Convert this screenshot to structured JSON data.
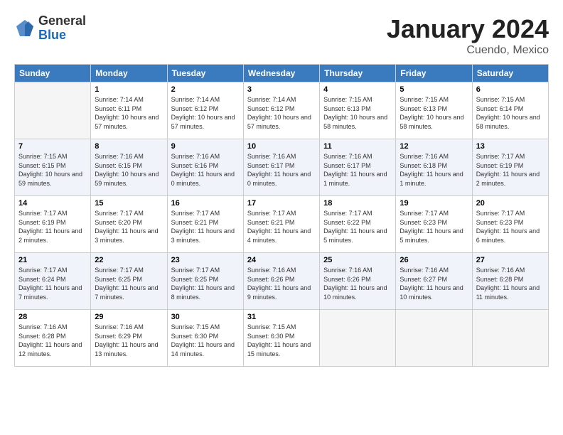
{
  "header": {
    "logo": {
      "line1": "General",
      "line2": "Blue"
    },
    "title": "January 2024",
    "location": "Cuendo, Mexico"
  },
  "weekdays": [
    "Sunday",
    "Monday",
    "Tuesday",
    "Wednesday",
    "Thursday",
    "Friday",
    "Saturday"
  ],
  "weeks": [
    [
      {
        "day": "",
        "sunrise": "",
        "sunset": "",
        "daylight": ""
      },
      {
        "day": "1",
        "sunrise": "Sunrise: 7:14 AM",
        "sunset": "Sunset: 6:11 PM",
        "daylight": "Daylight: 10 hours and 57 minutes."
      },
      {
        "day": "2",
        "sunrise": "Sunrise: 7:14 AM",
        "sunset": "Sunset: 6:12 PM",
        "daylight": "Daylight: 10 hours and 57 minutes."
      },
      {
        "day": "3",
        "sunrise": "Sunrise: 7:14 AM",
        "sunset": "Sunset: 6:12 PM",
        "daylight": "Daylight: 10 hours and 57 minutes."
      },
      {
        "day": "4",
        "sunrise": "Sunrise: 7:15 AM",
        "sunset": "Sunset: 6:13 PM",
        "daylight": "Daylight: 10 hours and 58 minutes."
      },
      {
        "day": "5",
        "sunrise": "Sunrise: 7:15 AM",
        "sunset": "Sunset: 6:13 PM",
        "daylight": "Daylight: 10 hours and 58 minutes."
      },
      {
        "day": "6",
        "sunrise": "Sunrise: 7:15 AM",
        "sunset": "Sunset: 6:14 PM",
        "daylight": "Daylight: 10 hours and 58 minutes."
      }
    ],
    [
      {
        "day": "7",
        "sunrise": "Sunrise: 7:15 AM",
        "sunset": "Sunset: 6:15 PM",
        "daylight": "Daylight: 10 hours and 59 minutes."
      },
      {
        "day": "8",
        "sunrise": "Sunrise: 7:16 AM",
        "sunset": "Sunset: 6:15 PM",
        "daylight": "Daylight: 10 hours and 59 minutes."
      },
      {
        "day": "9",
        "sunrise": "Sunrise: 7:16 AM",
        "sunset": "Sunset: 6:16 PM",
        "daylight": "Daylight: 11 hours and 0 minutes."
      },
      {
        "day": "10",
        "sunrise": "Sunrise: 7:16 AM",
        "sunset": "Sunset: 6:17 PM",
        "daylight": "Daylight: 11 hours and 0 minutes."
      },
      {
        "day": "11",
        "sunrise": "Sunrise: 7:16 AM",
        "sunset": "Sunset: 6:17 PM",
        "daylight": "Daylight: 11 hours and 1 minute."
      },
      {
        "day": "12",
        "sunrise": "Sunrise: 7:16 AM",
        "sunset": "Sunset: 6:18 PM",
        "daylight": "Daylight: 11 hours and 1 minute."
      },
      {
        "day": "13",
        "sunrise": "Sunrise: 7:17 AM",
        "sunset": "Sunset: 6:19 PM",
        "daylight": "Daylight: 11 hours and 2 minutes."
      }
    ],
    [
      {
        "day": "14",
        "sunrise": "Sunrise: 7:17 AM",
        "sunset": "Sunset: 6:19 PM",
        "daylight": "Daylight: 11 hours and 2 minutes."
      },
      {
        "day": "15",
        "sunrise": "Sunrise: 7:17 AM",
        "sunset": "Sunset: 6:20 PM",
        "daylight": "Daylight: 11 hours and 3 minutes."
      },
      {
        "day": "16",
        "sunrise": "Sunrise: 7:17 AM",
        "sunset": "Sunset: 6:21 PM",
        "daylight": "Daylight: 11 hours and 3 minutes."
      },
      {
        "day": "17",
        "sunrise": "Sunrise: 7:17 AM",
        "sunset": "Sunset: 6:21 PM",
        "daylight": "Daylight: 11 hours and 4 minutes."
      },
      {
        "day": "18",
        "sunrise": "Sunrise: 7:17 AM",
        "sunset": "Sunset: 6:22 PM",
        "daylight": "Daylight: 11 hours and 5 minutes."
      },
      {
        "day": "19",
        "sunrise": "Sunrise: 7:17 AM",
        "sunset": "Sunset: 6:23 PM",
        "daylight": "Daylight: 11 hours and 5 minutes."
      },
      {
        "day": "20",
        "sunrise": "Sunrise: 7:17 AM",
        "sunset": "Sunset: 6:23 PM",
        "daylight": "Daylight: 11 hours and 6 minutes."
      }
    ],
    [
      {
        "day": "21",
        "sunrise": "Sunrise: 7:17 AM",
        "sunset": "Sunset: 6:24 PM",
        "daylight": "Daylight: 11 hours and 7 minutes."
      },
      {
        "day": "22",
        "sunrise": "Sunrise: 7:17 AM",
        "sunset": "Sunset: 6:25 PM",
        "daylight": "Daylight: 11 hours and 7 minutes."
      },
      {
        "day": "23",
        "sunrise": "Sunrise: 7:17 AM",
        "sunset": "Sunset: 6:25 PM",
        "daylight": "Daylight: 11 hours and 8 minutes."
      },
      {
        "day": "24",
        "sunrise": "Sunrise: 7:16 AM",
        "sunset": "Sunset: 6:26 PM",
        "daylight": "Daylight: 11 hours and 9 minutes."
      },
      {
        "day": "25",
        "sunrise": "Sunrise: 7:16 AM",
        "sunset": "Sunset: 6:26 PM",
        "daylight": "Daylight: 11 hours and 10 minutes."
      },
      {
        "day": "26",
        "sunrise": "Sunrise: 7:16 AM",
        "sunset": "Sunset: 6:27 PM",
        "daylight": "Daylight: 11 hours and 10 minutes."
      },
      {
        "day": "27",
        "sunrise": "Sunrise: 7:16 AM",
        "sunset": "Sunset: 6:28 PM",
        "daylight": "Daylight: 11 hours and 11 minutes."
      }
    ],
    [
      {
        "day": "28",
        "sunrise": "Sunrise: 7:16 AM",
        "sunset": "Sunset: 6:28 PM",
        "daylight": "Daylight: 11 hours and 12 minutes."
      },
      {
        "day": "29",
        "sunrise": "Sunrise: 7:16 AM",
        "sunset": "Sunset: 6:29 PM",
        "daylight": "Daylight: 11 hours and 13 minutes."
      },
      {
        "day": "30",
        "sunrise": "Sunrise: 7:15 AM",
        "sunset": "Sunset: 6:30 PM",
        "daylight": "Daylight: 11 hours and 14 minutes."
      },
      {
        "day": "31",
        "sunrise": "Sunrise: 7:15 AM",
        "sunset": "Sunset: 6:30 PM",
        "daylight": "Daylight: 11 hours and 15 minutes."
      },
      {
        "day": "",
        "sunrise": "",
        "sunset": "",
        "daylight": ""
      },
      {
        "day": "",
        "sunrise": "",
        "sunset": "",
        "daylight": ""
      },
      {
        "day": "",
        "sunrise": "",
        "sunset": "",
        "daylight": ""
      }
    ]
  ]
}
